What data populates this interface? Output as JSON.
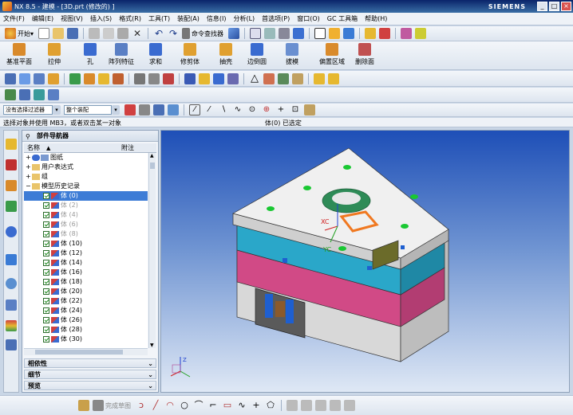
{
  "window": {
    "title": "NX 8.5 - 建模 - [3D.prt  (修改的) ]",
    "brand": "SIEMENS",
    "min_label": "_",
    "max_label": "□",
    "close_label": "×"
  },
  "menubar": {
    "items": [
      "文件(F)",
      "编辑(E)",
      "视图(V)",
      "插入(S)",
      "格式(R)",
      "工具(T)",
      "装配(A)",
      "信息(I)",
      "分析(L)",
      "首选项(P)",
      "窗口(O)",
      "GC 工具箱",
      "帮助(H)"
    ]
  },
  "standard_toolbar": {
    "start_label": "开始▾",
    "command_finder_label": "命令查找器"
  },
  "feature_toolbar": {
    "buttons": [
      {
        "label": "基准平面",
        "icon": "datum-plane-icon",
        "color": "#d98a2b"
      },
      {
        "label": "拉伸",
        "icon": "extrude-icon",
        "color": "#e0a030"
      },
      {
        "label": "孔",
        "icon": "hole-icon",
        "color": "#3a6bd0"
      },
      {
        "label": "阵列特征",
        "icon": "pattern-icon",
        "color": "#5a7fc4"
      },
      {
        "label": "求和",
        "icon": "unite-icon",
        "color": "#3a6bd0"
      },
      {
        "label": "修剪体",
        "icon": "trim-body-icon",
        "color": "#e0a030"
      },
      {
        "label": "抽壳",
        "icon": "shell-icon",
        "color": "#e0a030"
      },
      {
        "label": "边倒圆",
        "icon": "edge-blend-icon",
        "color": "#3a6bd0"
      },
      {
        "label": "拔模",
        "icon": "draft-icon",
        "color": "#6a8fd0"
      },
      {
        "label": "偏置区域",
        "icon": "offset-region-icon",
        "color": "#d98a2b"
      },
      {
        "label": "删除面",
        "icon": "delete-face-icon",
        "color": "#c05050"
      }
    ]
  },
  "selection_bar": {
    "filter_value": "没有选择过滤器",
    "scope_value": "整个装配"
  },
  "status": {
    "prompt": "选择对象并使用 MB3，或者双击某一对象",
    "message": "体(0) 已选定"
  },
  "navigator": {
    "title": "部件导航器",
    "col_name": "名称",
    "col_note": "附注",
    "top_nodes": [
      {
        "expander": "+",
        "label": "图纸"
      },
      {
        "expander": "+",
        "label": "用户表达式"
      },
      {
        "expander": "+",
        "label": "组"
      },
      {
        "expander": "−",
        "label": "模型历史记录"
      }
    ],
    "bodies": [
      {
        "label": "体 (0)",
        "grey": false,
        "selected": true
      },
      {
        "label": "体 (2)",
        "grey": true,
        "selected": false
      },
      {
        "label": "体 (4)",
        "grey": true,
        "selected": false
      },
      {
        "label": "体 (6)",
        "grey": true,
        "selected": false
      },
      {
        "label": "体 (8)",
        "grey": true,
        "selected": false
      },
      {
        "label": "体 (10)",
        "grey": false,
        "selected": false
      },
      {
        "label": "体 (12)",
        "grey": false,
        "selected": false
      },
      {
        "label": "体 (14)",
        "grey": false,
        "selected": false
      },
      {
        "label": "体 (16)",
        "grey": false,
        "selected": false
      },
      {
        "label": "体 (18)",
        "grey": false,
        "selected": false
      },
      {
        "label": "体 (20)",
        "grey": false,
        "selected": false
      },
      {
        "label": "体 (22)",
        "grey": false,
        "selected": false
      },
      {
        "label": "体 (24)",
        "grey": false,
        "selected": false
      },
      {
        "label": "体 (26)",
        "grey": false,
        "selected": false
      },
      {
        "label": "体 (28)",
        "grey": false,
        "selected": false
      },
      {
        "label": "体 (30)",
        "grey": false,
        "selected": false
      }
    ],
    "panels": [
      "相依性",
      "细节",
      "预览"
    ]
  },
  "viewport": {
    "axis_xc": "XC",
    "axis_yc": "YC",
    "triad_z": "Z"
  },
  "bottom_toolbar": {
    "sketch_label": "完成草图"
  }
}
